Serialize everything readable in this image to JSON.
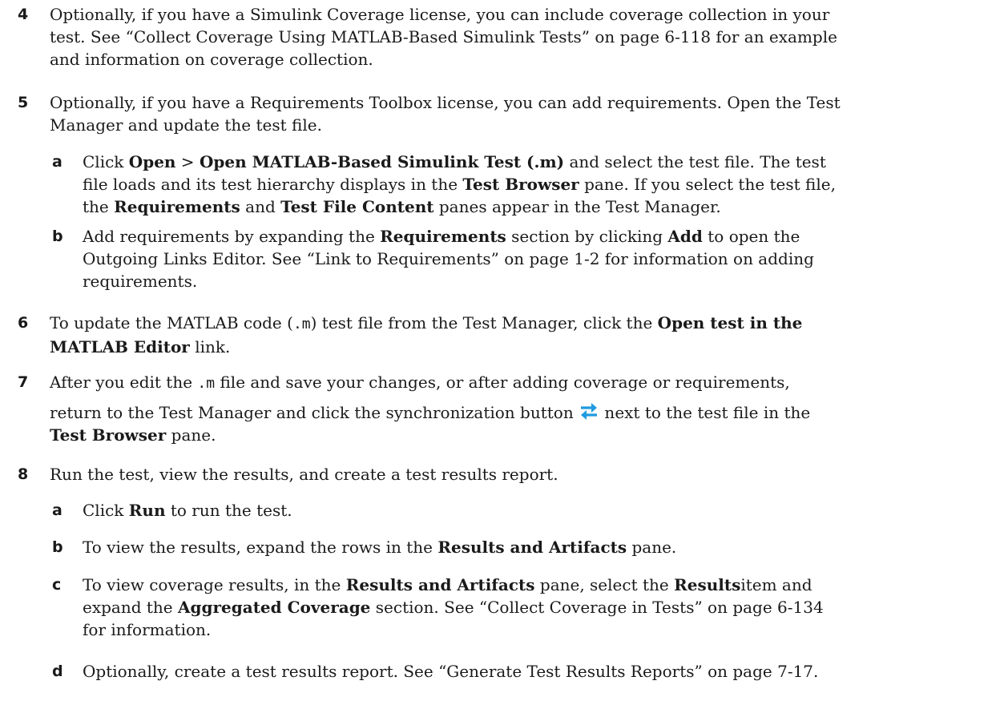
{
  "steps": {
    "s4": {
      "number": "4",
      "l1": "Optionally, if you have a Simulink Coverage license, you can include coverage collection in your",
      "l2": "test. See “Collect Coverage Using MATLAB-Based Simulink Tests” on page 6-118 for an example",
      "l3": "and information on coverage collection."
    },
    "s5": {
      "number": "5",
      "l1": "Optionally, if you have a Requirements Toolbox license, you can add requirements. Open the Test",
      "l2": "Manager and update the test file.",
      "a": {
        "letter": "a",
        "l1_t1": "Click ",
        "l1_b1": "Open",
        "l1_t2": " > ",
        "l1_b2": "Open MATLAB-Based Simulink Test (.m)",
        "l1_t3": " and select the test file. The test",
        "l2_t1": "file loads and its test hierarchy displays in the ",
        "l2_b1": "Test Browser",
        "l2_t2": " pane. If you select the test file,",
        "l3_t1": "the ",
        "l3_b1": "Requirements",
        "l3_t2": " and ",
        "l3_b2": "Test File Content",
        "l3_t3": " panes appear in the Test Manager."
      },
      "b": {
        "letter": "b",
        "l1_t1": "Add requirements by expanding the ",
        "l1_b1": "Requirements",
        "l1_t2": " section by clicking ",
        "l1_b2": "Add",
        "l1_t3": " to open the",
        "l2": "Outgoing Links Editor. See “Link to Requirements” on page 1-2 for information on adding",
        "l3": "requirements."
      }
    },
    "s6": {
      "number": "6",
      "l1_t1": "To update the MATLAB code (",
      "l1_code": ".m",
      "l1_t2": ") test file from the Test Manager, click the ",
      "l1_b1": "Open test in the",
      "l2_b1": "MATLAB Editor",
      "l2_t1": " link."
    },
    "s7": {
      "number": "7",
      "l1_t1": "After you edit the ",
      "l1_code": ".m",
      "l1_t2": " file and save your changes, or after adding coverage or requirements,",
      "l2_t1": "return to the Test Manager and click the synchronization button ",
      "l2_t2": " next to the test file in the",
      "l3_b1": "Test Browser",
      "l3_t1": " pane.",
      "icon": "sync-arrows-icon",
      "icon_color": "#1f9be0"
    },
    "s8": {
      "number": "8",
      "l1": "Run the test, view the results, and create a test results report.",
      "a": {
        "letter": "a",
        "t1": "Click ",
        "b1": "Run",
        "t2": " to run the test."
      },
      "b": {
        "letter": "b",
        "t1": "To view the results, expand the rows in the ",
        "b1": "Results and Artifacts",
        "t2": " pane."
      },
      "c": {
        "letter": "c",
        "l1_t1": "To view coverage results, in the ",
        "l1_b1": "Results and Artifacts",
        "l1_t2": " pane, select the ",
        "l1_b2": "Results",
        "l1_t3": "item and",
        "l2_t1": "expand the ",
        "l2_b1": "Aggregated Coverage",
        "l2_t2": " section. See “Collect Coverage in Tests” on page 6-134",
        "l3": "for information."
      },
      "d": {
        "letter": "d",
        "l1": "Optionally, create a test results report. See “Generate Test Results Reports” on page 7-17."
      }
    }
  }
}
